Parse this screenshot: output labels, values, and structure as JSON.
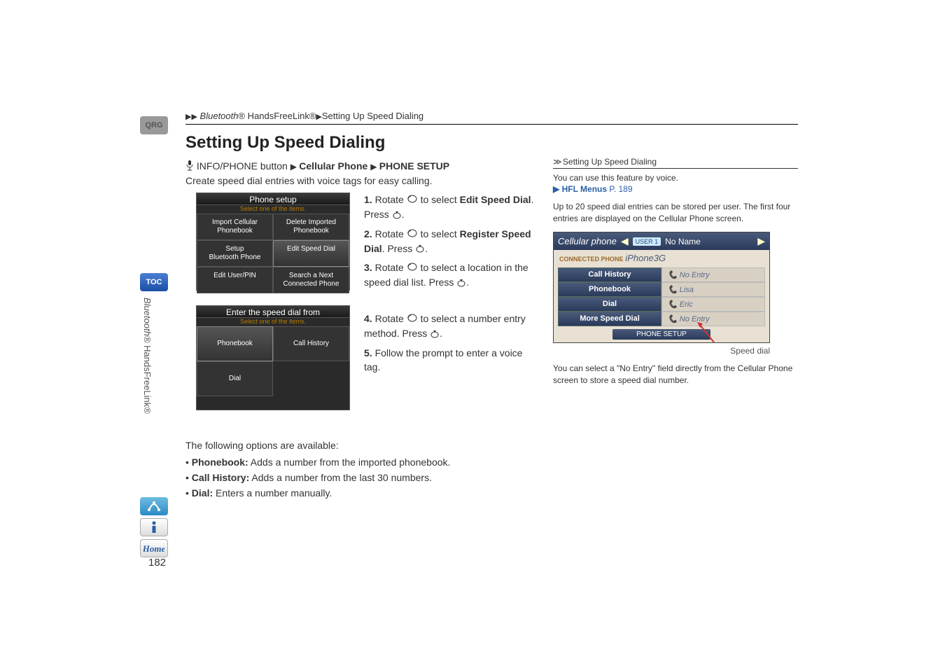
{
  "breadcrumb": {
    "seg1_italic": "Bluetooth",
    "seg1_rest": "® HandsFreeLink®",
    "seg2": "Setting Up Speed Dialing"
  },
  "side_tabs": {
    "qrg": "QRG",
    "toc": "TOC"
  },
  "vertical_label": {
    "italic": "Bluetooth",
    "rest": "® HandsFreeLink®"
  },
  "page_number": "182",
  "heading": "Setting Up Speed Dialing",
  "nav_path": {
    "prefix": "INFO/PHONE button",
    "seg1": "Cellular Phone",
    "seg2": "PHONE SETUP"
  },
  "intro": "Create speed dial entries with voice tags for easy calling.",
  "shot1": {
    "title": "Phone setup",
    "subtitle": "Select one of the items.",
    "cells": {
      "c0": "Import Cellular\nPhonebook",
      "c1": "Delete Imported\nPhonebook",
      "c2": "Setup\nBluetooth Phone",
      "c3": "Edit Speed Dial",
      "c4": "Edit User/PIN",
      "c5": "Search a Next\nConnected Phone"
    }
  },
  "shot2": {
    "title": "Enter the speed dial from",
    "subtitle": "Select one of the items.",
    "cells": {
      "c0": "Phonebook",
      "c1": "Call History",
      "c2": "Dial"
    }
  },
  "steps": {
    "s1a": "1.",
    "s1b": " Rotate ",
    "s1c": " to select ",
    "s1d": "Edit Speed Dial",
    "s1e": ". Press ",
    "s1f": ".",
    "s2a": "2.",
    "s2b": " Rotate ",
    "s2c": " to select ",
    "s2d": "Register Speed Dial",
    "s2e": ". Press ",
    "s2f": ".",
    "s3a": "3.",
    "s3b": " Rotate ",
    "s3c": " to select a location in the speed dial list. Press ",
    "s3f": ".",
    "s4a": "4.",
    "s4b": " Rotate ",
    "s4c": " to select a number entry method. Press ",
    "s4f": ".",
    "s5a": "5.",
    "s5b": " Follow the prompt to enter a voice tag."
  },
  "options_intro": "The following options are available:",
  "options": {
    "o1_label": "Phonebook:",
    "o1_text": " Adds a number from the imported phonebook.",
    "o2_label": "Call History:",
    "o2_text": " Adds a number from the last 30 numbers.",
    "o3_label": "Dial:",
    "o3_text": " Enters a number manually."
  },
  "sidebar": {
    "head": "Setting Up Speed Dialing",
    "note1": "You can use this feature by voice.",
    "link_label": "HFL Menus",
    "link_page": " P. 189",
    "note2": "Up to 20 speed dial entries can be stored per user. The first four entries are displayed on the Cellular Phone screen.",
    "sd_label": "Speed dial",
    "note3": "You can select a \"No Entry\" field directly from the Cellular Phone screen to store a speed dial number."
  },
  "cel_shot": {
    "title": "Cellular phone",
    "user_badge": "USER 1",
    "noname": "No Name",
    "conn_badge": "CONNECTED PHONE",
    "conn_phone": "iPhone3G",
    "rows": {
      "l0": "Call History",
      "r0": "No Entry",
      "l1": "Phonebook",
      "r1": "Lisa",
      "l2": "Dial",
      "r2": "Eric",
      "l3": "More Speed Dial",
      "r3": "No Entry"
    },
    "bottom": "PHONE SETUP"
  }
}
